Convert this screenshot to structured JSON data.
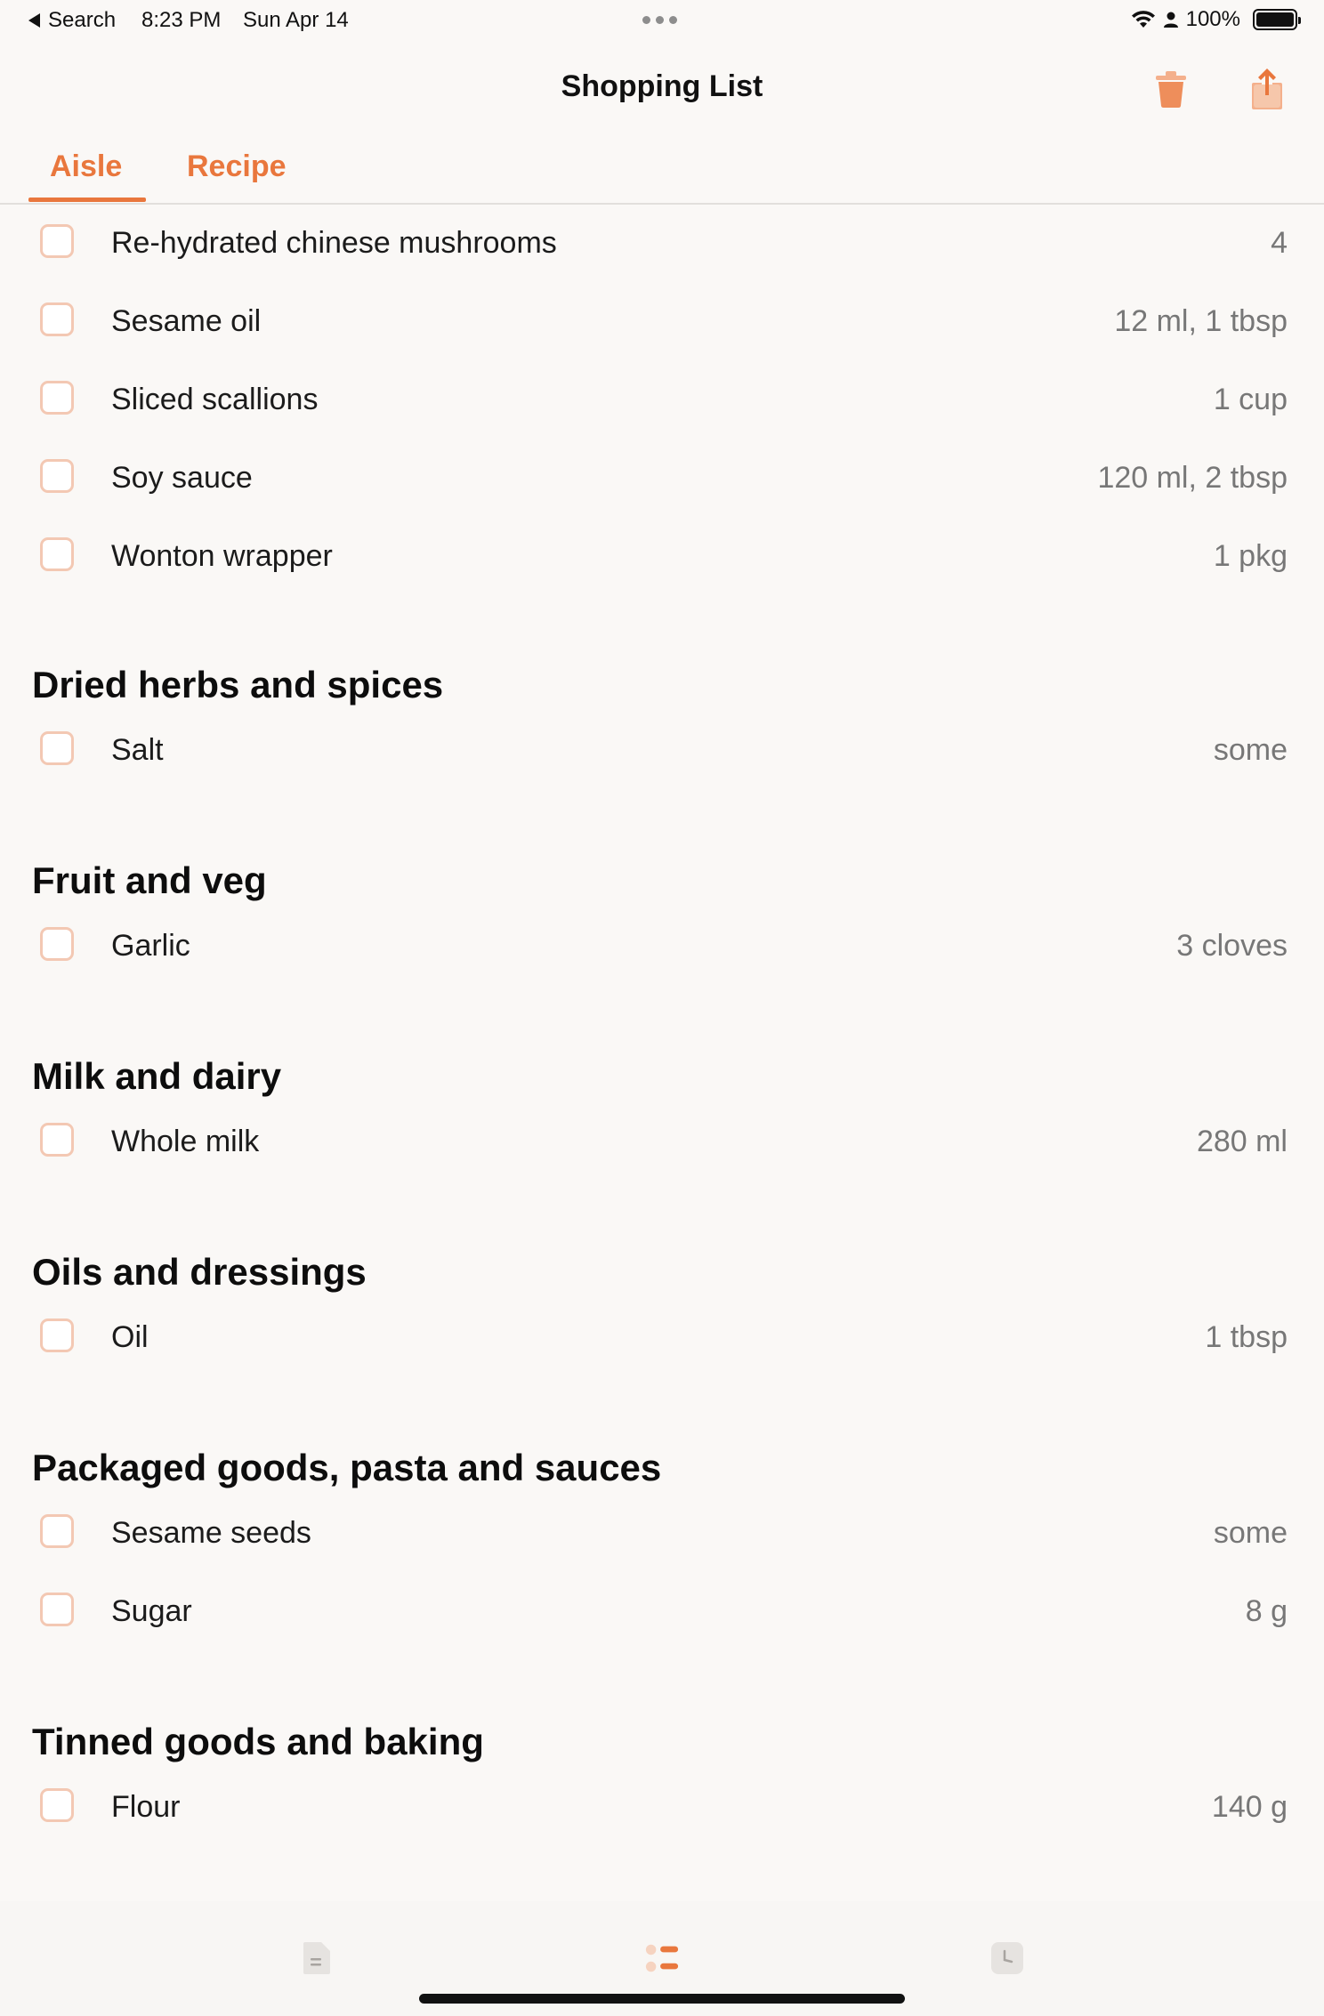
{
  "status_bar": {
    "back_label": "Search",
    "time": "8:23 PM",
    "date": "Sun Apr 14",
    "battery": "100%"
  },
  "nav": {
    "title": "Shopping List",
    "trash_icon": "trash-icon",
    "share_icon": "share-icon"
  },
  "tabs": {
    "aisle": "Aisle",
    "recipe": "Recipe",
    "selected": "Aisle"
  },
  "top_items": [
    {
      "name": "Re-hydrated chinese mushrooms",
      "qty": "4"
    },
    {
      "name": "Sesame oil",
      "qty": "12 ml, 1 tbsp"
    },
    {
      "name": "Sliced scallions",
      "qty": "1 cup"
    },
    {
      "name": "Soy sauce",
      "qty": "120 ml, 2 tbsp"
    },
    {
      "name": "Wonton wrapper",
      "qty": "1 pkg"
    }
  ],
  "sections": [
    {
      "title": "Dried herbs and spices",
      "items": [
        {
          "name": "Salt",
          "qty": "some"
        }
      ]
    },
    {
      "title": "Fruit and veg",
      "items": [
        {
          "name": "Garlic",
          "qty": "3 cloves"
        }
      ]
    },
    {
      "title": "Milk and dairy",
      "items": [
        {
          "name": "Whole milk",
          "qty": "280 ml"
        }
      ]
    },
    {
      "title": "Oils and dressings",
      "items": [
        {
          "name": "Oil",
          "qty": "1 tbsp"
        }
      ]
    },
    {
      "title": "Packaged goods, pasta and sauces",
      "items": [
        {
          "name": "Sesame seeds",
          "qty": "some"
        },
        {
          "name": "Sugar",
          "qty": "8 g"
        }
      ]
    },
    {
      "title": "Tinned goods and baking",
      "items": [
        {
          "name": "Flour",
          "qty": "140 g"
        }
      ]
    }
  ],
  "tab_bar": {
    "icons": [
      "recipes-icon",
      "shopping-list-icon",
      "history-icon"
    ],
    "selected": "shopping-list-icon"
  },
  "colors": {
    "accent": "#e9773d",
    "checkbox_border": "#f3c8b3",
    "background": "#faf8f6"
  }
}
